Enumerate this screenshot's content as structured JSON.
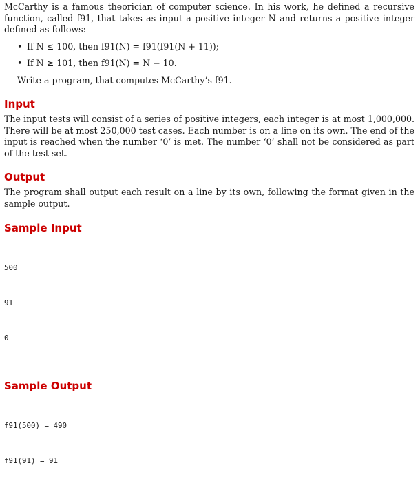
{
  "intro": {
    "text": "McCarthy is a famous theorician of computer science. In his work, he defined a recursive function, called f91, that takes as input a positive integer N and returns a positive integer defined as follows:"
  },
  "rules": [
    {
      "text": "If N ≤ 100, then f91(N) = f91(f91(N + 11));"
    },
    {
      "text": "If N ≥ 101, then f91(N) = N − 10."
    }
  ],
  "task": "Write a program, that computes McCarthy’s f91.",
  "input_section": {
    "heading": "Input",
    "body": "The input tests will consist of a series of positive integers, each integer is at most 1,000,000. There will be at most 250,000 test cases. Each number is on a line on its own. The end of the input is reached when the number ‘0’ is met. The number ‘0’ shall not be considered as part of the test set."
  },
  "output_section": {
    "heading": "Output",
    "body": "The program shall output each result on a line by its own, following the format given in the sample output."
  },
  "sample_input": {
    "heading": "Sample Input",
    "lines": [
      "500",
      "91",
      "0"
    ]
  },
  "sample_output": {
    "heading": "Sample Output",
    "lines": [
      "f91(500) = 490",
      "f91(91) = 91"
    ]
  }
}
